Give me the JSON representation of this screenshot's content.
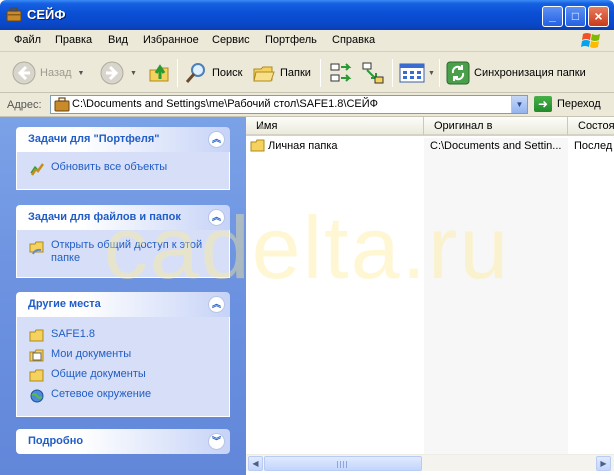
{
  "window": {
    "title": "СЕЙФ",
    "controls": {
      "minimize": "_",
      "maximize": "□",
      "close": "×"
    }
  },
  "menu": [
    "Файл",
    "Правка",
    "Вид",
    "Избранное",
    "Сервис",
    "Портфель",
    "Справка"
  ],
  "toolbar": {
    "back": "Назад",
    "search": "Поиск",
    "folders": "Папки",
    "sync": "Синхронизация папки"
  },
  "address": {
    "label": "Адрес:",
    "value": "C:\\Documents and Settings\\me\\Рабочий стол\\SAFE1.8\\СЕЙФ",
    "go": "Переход"
  },
  "taskpane": {
    "panels": [
      {
        "title": "Задачи для \"Портфеля\"",
        "tasks": [
          "Обновить все объекты"
        ]
      },
      {
        "title": "Задачи для файлов и папок",
        "tasks": [
          "Открыть общий доступ к этой папке"
        ]
      },
      {
        "title": "Другие места",
        "tasks": [
          "SAFE1.8",
          "Мои документы",
          "Общие документы",
          "Сетевое окружение"
        ]
      },
      {
        "title": "Подробно",
        "tasks": []
      }
    ]
  },
  "list": {
    "columns": [
      "Имя",
      "Оригинал в",
      "Состоя"
    ],
    "rows": [
      {
        "name": "Личная папка",
        "original": "C:\\Documents and Settin...",
        "status": "Послед"
      }
    ]
  },
  "watermark": "cadelta.ru",
  "colors": {
    "titlebar": "#0a4fd6",
    "taskpane": "#6b91e0",
    "link": "#215dc6"
  }
}
